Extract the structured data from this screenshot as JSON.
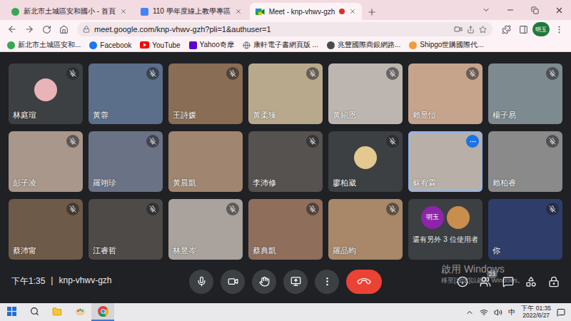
{
  "browser": {
    "tabs": [
      {
        "title": "新北市土城區安和國小 - 首頁",
        "selected": false,
        "recording": false
      },
      {
        "title": "110 學年度線上教學專區",
        "selected": false,
        "recording": false
      },
      {
        "title": "Meet - knp-vhwv-gzh",
        "selected": true,
        "recording": true
      }
    ],
    "address": "meet.google.com/knp-vhwv-gzh?pli=1&authuser=1",
    "profile": "明玉",
    "bookmarks": [
      "新北市土城區安和...",
      "Facebook",
      "YouTube",
      "Yahoo奇摩",
      "康軒電子書網頁版 ...",
      "兆豐國際商銀網路...",
      "Shipgo世購國際代..."
    ]
  },
  "meeting": {
    "tiles": [
      {
        "name": "林庭瑄",
        "kind": "avatar",
        "muted": true,
        "highlighted": false,
        "color": "#e8b4b8"
      },
      {
        "name": "黃蓉",
        "kind": "video",
        "muted": true,
        "highlighted": false,
        "color": "#5b6f8a"
      },
      {
        "name": "王詩媛",
        "kind": "video",
        "muted": true,
        "highlighted": false,
        "color": "#8a6d55"
      },
      {
        "name": "黃柔臻",
        "kind": "video",
        "muted": true,
        "highlighted": false,
        "color": "#b9a98c"
      },
      {
        "name": "黃紹恩",
        "kind": "video",
        "muted": true,
        "highlighted": false,
        "color": "#bdb6b0"
      },
      {
        "name": "賴昱愷",
        "kind": "video",
        "muted": true,
        "highlighted": false,
        "color": "#c6a48c"
      },
      {
        "name": "楊子易",
        "kind": "video",
        "muted": true,
        "highlighted": false,
        "color": "#7d8a8f"
      },
      {
        "name": "彭子凌",
        "kind": "video",
        "muted": true,
        "highlighted": false,
        "color": "#a8978a"
      },
      {
        "name": "羅翊珍",
        "kind": "video",
        "muted": true,
        "highlighted": false,
        "color": "#6a7286"
      },
      {
        "name": "黃晨凱",
        "kind": "video",
        "muted": false,
        "highlighted": false,
        "color": "#a08570"
      },
      {
        "name": "李沛修",
        "kind": "video",
        "muted": true,
        "highlighted": false,
        "color": "#55524f"
      },
      {
        "name": "廖柏崴",
        "kind": "avatar",
        "muted": true,
        "highlighted": false,
        "color": "#e3c990"
      },
      {
        "name": "蘇宥霖",
        "kind": "video",
        "muted": false,
        "highlighted": true,
        "color": "#b8b0a8"
      },
      {
        "name": "賴柏睿",
        "kind": "video",
        "muted": true,
        "highlighted": false,
        "color": "#8a8a8a"
      },
      {
        "name": "蔡沛甯",
        "kind": "video",
        "muted": true,
        "highlighted": false,
        "color": "#6e5a48"
      },
      {
        "name": "江睿哲",
        "kind": "video",
        "muted": true,
        "highlighted": false,
        "color": "#4d4a47"
      },
      {
        "name": "林昱岑",
        "kind": "video",
        "muted": true,
        "highlighted": false,
        "color": "#a9a29d"
      },
      {
        "name": "蔡典凱",
        "kind": "video",
        "muted": true,
        "highlighted": false,
        "color": "#8f6e5c"
      },
      {
        "name": "羅品昀",
        "kind": "video",
        "muted": true,
        "highlighted": false,
        "color": "#a88868"
      },
      {
        "label": "還有另外 3 位使用者",
        "kind": "others",
        "muted": false,
        "highlighted": false,
        "color": "#3c4043",
        "avatars": [
          {
            "label": "明玉",
            "color": "#8e24aa"
          },
          {
            "color": "#c98d4e"
          }
        ]
      },
      {
        "name": "你",
        "kind": "video",
        "muted": true,
        "highlighted": false,
        "color": "#2f3d6b"
      }
    ],
    "time": "下午1:35",
    "separator": "|",
    "code": "knp-vhwv-gzh",
    "participants_badge": "23",
    "mic_on": true,
    "camera_on": true
  },
  "watermark": {
    "title": "啟用 Windows",
    "subtitle": "移至[設定]以啟用 Windows。"
  },
  "taskbar": {
    "ime": "中",
    "time": "下午 01:35",
    "date": "2022/6/27"
  }
}
